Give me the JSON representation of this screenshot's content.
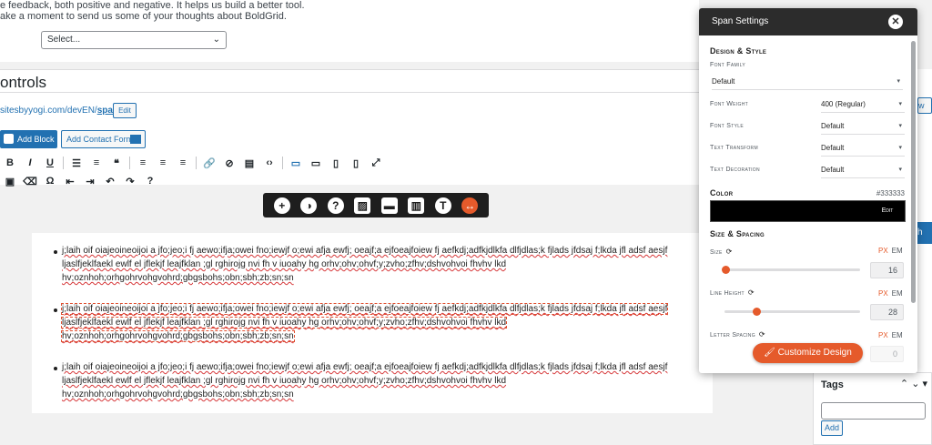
{
  "feedback": {
    "line1": "e feedback, both positive and negative. It helps us build a better tool.",
    "line2": "ake a moment to send us some of your thoughts about BoldGrid.",
    "select_value": "Select..."
  },
  "controls": {
    "title": "ontrols",
    "permalink_base": "sitesbyyogi.com/devEN/",
    "permalink_slug": "spacing",
    "permalink_end": "/",
    "edit_label": "Edit",
    "add_block_label": "Add Block",
    "add_contact_label": "Add Contact Form"
  },
  "floating_toolbar": {
    "icons": [
      "plus-icon",
      "palette-icon",
      "help-icon",
      "image-icon",
      "box-icon",
      "column-icon",
      "text-icon",
      "arrows-icon"
    ]
  },
  "content": {
    "paragraph": "j;laih oif oiajeoineoijoi a jfo;jeo;i fj aewo;ifja;owei fno;iewjf o;ewi afja ewfj; oeajf;a ejfoeajfoiew fj aefkdj;adfkjdlkfa dlfjdlas;k fjlads jfdsaj f;lkda jfl adsf aesjf ljaslfjeklfaekl ewlf el jflekjf leajfklan ;gl rghirojg nvi fh v iuoahy hg orhv;ohv;ohvf;y;zvho;zfhv;dshvohvoi fhvhv lkd hv;oznhoh;orhgohrvohgvohrd;gbgsbohs;obn;sbh;zb;sn;sn",
    "line_a": "j;laih oif oiajeoineoijoi a jfo;jeo;i fj aewo;ifja;owei fno;iewjf o;ewi afja ewfj; oeajf;a ejfoeajfoiew fj aefkdj;adfkjdlkfa dlfjdlas;k fjlads jfdsaj f;lkda jfl adsf aesjf",
    "line_b": "ljaslfjeklfaekl ewlf el jflekjf leajfklan ;gl rghirojg nvi fh v iuoahy hg orhv;ohv;ohvf;y;zvho;zfhv;dshvohvoi fhvhv lkd",
    "line_c": "hv;oznhoh;orhgohrvohgvohrd;gbgsbohs;obn;sbh;zb;sn;sn"
  },
  "sidebar": {
    "button_label": "w",
    "blue_label": "h",
    "tags_title": "Tags",
    "tags_add_label": "Add"
  },
  "span_settings": {
    "title": "Span Settings",
    "design_section": "Design & Style",
    "font_family_label": "Font Family",
    "font_family_value": "Default",
    "font_weight_label": "Font Weight",
    "font_weight_value": "400 (Regular)",
    "font_style_label": "Font Style",
    "font_style_value": "Default",
    "text_transform_label": "Text Transform",
    "text_transform_value": "Default",
    "text_decoration_label": "Text Decoration",
    "text_decoration_value": "Default",
    "color_label": "Color",
    "color_value": "#333333",
    "color_edit_label": "Edit",
    "spacing_section": "Size & Spacing",
    "size_label": "Size",
    "size_value": "16",
    "line_height_label": "Line Height",
    "line_height_value": "28",
    "letter_spacing_label": "Letter Spacing",
    "letter_spacing_value": "0",
    "unit_px": "PX",
    "unit_em": "EM",
    "customize_label": "Customize Design",
    "accent_color": "#e55a2b"
  }
}
